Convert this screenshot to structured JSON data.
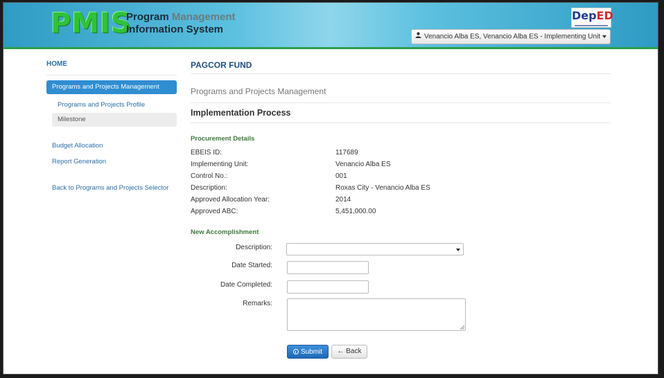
{
  "header": {
    "logo_text": "PMIS",
    "subtitle_line1_a": "Program",
    "subtitle_line1_b": "Management",
    "subtitle_line2": "Information System",
    "deped_logo_a": "Dep",
    "deped_logo_b": "ED",
    "user_menu": "Venancio Alba ES, Venancio Alba ES - Implementing Unit"
  },
  "sidebar": {
    "home": "HOME",
    "active_item": "Programs and Projects Management",
    "sub_items": [
      "Programs and Projects Profile",
      "Milestone"
    ],
    "links": [
      "Budget Allocation",
      "Report Generation",
      "Back to Programs and Projects Selector"
    ]
  },
  "main": {
    "fund_title": "PAGCOR FUND",
    "section_title": "Programs and Projects Management",
    "process_title": "Implementation Process",
    "procurement_heading": "Procurement Details",
    "details": [
      {
        "label": "EBEIS ID:",
        "value": "117689"
      },
      {
        "label": "Implementing Unit:",
        "value": "Venancio Alba ES"
      },
      {
        "label": "Control No.:",
        "value": "001"
      },
      {
        "label": "Description:",
        "value": "Roxas City - Venancio Alba ES"
      },
      {
        "label": "Approved Allocation Year:",
        "value": "2014"
      },
      {
        "label": "Approved ABC:",
        "value": "5,451,000.00"
      }
    ],
    "accomplishment_heading": "New Accomplishment",
    "form": {
      "description_label": "Description:",
      "description_value": "",
      "date_started_label": "Date Started:",
      "date_started_value": "",
      "date_completed_label": "Date Completed:",
      "date_completed_value": "",
      "remarks_label": "Remarks:",
      "remarks_value": ""
    },
    "submit_label": "Submit",
    "back_label": "Back"
  },
  "colors": {
    "header": "#5cc0df",
    "accent": "#2f8dd1",
    "section_heading": "#3f7a3b",
    "logo_green": "#2fc23a"
  }
}
